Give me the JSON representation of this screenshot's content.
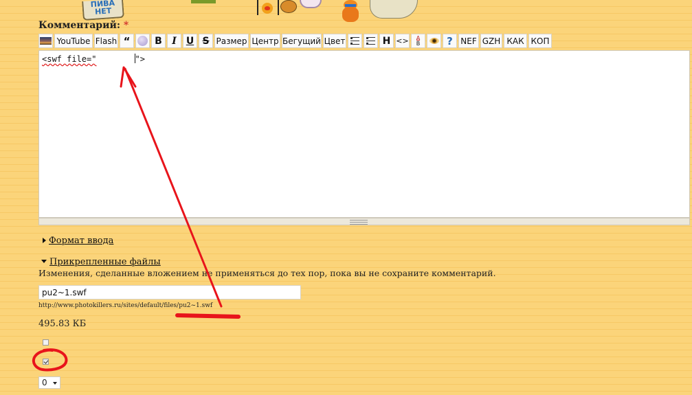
{
  "header": {
    "sticker_text": [
      "ПИВА",
      "НЕТ"
    ]
  },
  "form": {
    "comment_label": "Комментарий:",
    "required_mark": "*"
  },
  "toolbar": {
    "buttons": [
      {
        "label": "",
        "icon": "image-icon"
      },
      {
        "label": "YouTube"
      },
      {
        "label": "Flash"
      },
      {
        "label": "“",
        "icon": "quote-icon"
      },
      {
        "label": "",
        "icon": "smiley-icon"
      },
      {
        "label": "B",
        "icon": "bold-icon"
      },
      {
        "label": "I",
        "icon": "italic-icon"
      },
      {
        "label": "U",
        "icon": "underline-icon"
      },
      {
        "label": "S",
        "icon": "strikethrough-icon"
      },
      {
        "label": "Размер"
      },
      {
        "label": "Центр"
      },
      {
        "label": "Бегущий"
      },
      {
        "label": "Цвет"
      },
      {
        "label": "",
        "icon": "ordered-list-icon"
      },
      {
        "label": "",
        "icon": "unordered-list-icon"
      },
      {
        "label": "H",
        "icon": "heading-icon"
      },
      {
        "label": "<>",
        "icon": "code-icon"
      },
      {
        "label": "",
        "icon": "spoiler-ab-icon"
      },
      {
        "label": "",
        "icon": "eye-icon"
      },
      {
        "label": "?",
        "icon": "help-icon"
      },
      {
        "label": "NEF"
      },
      {
        "label": "GZH"
      },
      {
        "label": "КАК"
      },
      {
        "label": "КОП"
      }
    ]
  },
  "editor": {
    "text_before": "<swf file=\"",
    "text_after": "\">"
  },
  "input_format": {
    "label": "Формат ввода"
  },
  "attachments": {
    "label": "Прикрепленные файлы",
    "description": "Изменения, сделанные вложением не применяться до тех пор, пока вы не сохраните комментарий.",
    "file": {
      "name": "pu2~1.swf",
      "url": "http://www.photokillers.ru/sites/default/files/pu2~1.swf",
      "size": "495.83 КБ",
      "remove_checked": false,
      "list_checked": true,
      "weight": "0"
    }
  },
  "annotation_color": "#e8141b"
}
